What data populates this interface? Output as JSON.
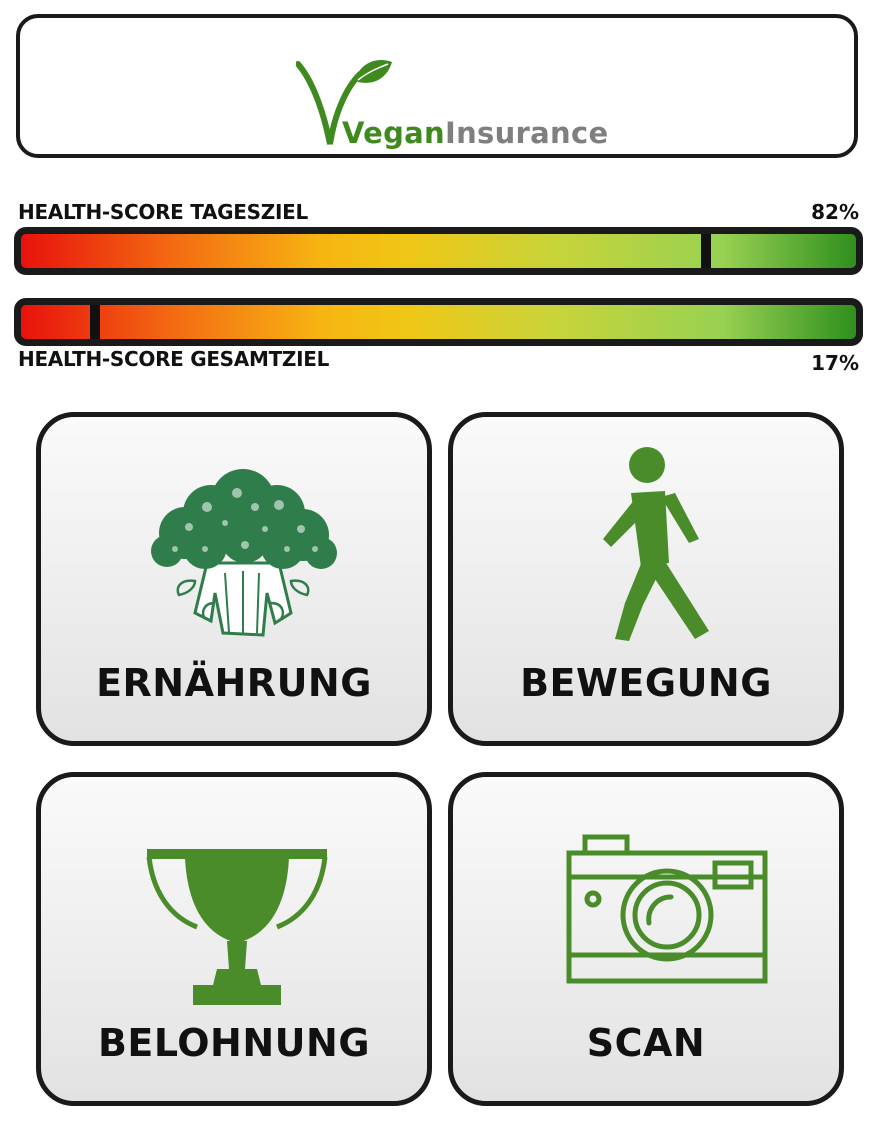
{
  "header": {
    "logo_vegan": "Vegan",
    "logo_insurance": "Insurance",
    "brand_green": "#3f8a1e",
    "brand_gray": "#7f7f7f"
  },
  "scores": {
    "daily": {
      "label": "HEALTH-SCORE TAGESZIEL",
      "value_text": "82%",
      "percent": 82
    },
    "total": {
      "label": "HEALTH-SCORE GESAMTZIEL",
      "value_text": "17%",
      "percent": 17
    }
  },
  "tiles": [
    {
      "label": "ERNÄHRUNG",
      "icon": "broccoli-icon"
    },
    {
      "label": "BEWEGUNG",
      "icon": "walking-person-icon"
    },
    {
      "label": "BELOHNUNG",
      "icon": "trophy-icon"
    },
    {
      "label": "SCAN",
      "icon": "camera-icon"
    }
  ],
  "colors": {
    "icon_green": "#4a8c2a",
    "border": "#1a1a1a"
  }
}
